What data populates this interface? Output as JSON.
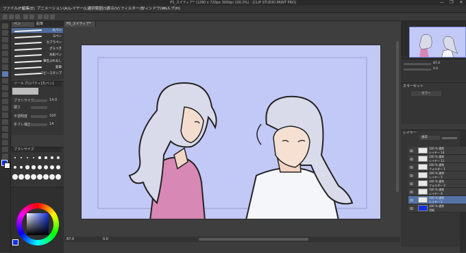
{
  "window": {
    "title": "PS_スイティア* (1280 x 720px 300dpi 100.0%) - [CLIP STUDIO PAINT PRO]",
    "controls": [
      "—",
      "❐",
      "✕"
    ]
  },
  "menu": [
    "ファイル(F)",
    "編集(E)",
    "アニメーション(A)",
    "レイヤー(L)",
    "選択範囲(S)",
    "表示(V)",
    "フィルター(I)",
    "ウィンドウ(W)",
    "ヘルプ(H)"
  ],
  "subtool": {
    "tabs": [
      "ペン",
      "鉛筆"
    ],
    "brushes": [
      "丸ペン",
      "Gペン",
      "カブラペン",
      "ざらつき",
      "水彩ペン",
      "筆圧ぶれなし",
      "鉛筆",
      "コピースタンプ"
    ],
    "selected_index": 0
  },
  "tool_property": {
    "title": "ツールプロパティ[丸ペン]",
    "rows": [
      {
        "label": "ブラシサイズ",
        "value": "14.0"
      },
      {
        "label": "硬さ",
        "value": ""
      },
      {
        "label": "不透明度",
        "value": "100"
      },
      {
        "label": "手ブレ補正",
        "value": "14"
      }
    ]
  },
  "brush_size_panel": {
    "title": "ブラシサイズ"
  },
  "canvas_tab": {
    "label": "PS_スイティア*"
  },
  "statusbar": {
    "zoom": "87.0",
    "angle": "0.0"
  },
  "navigator": {
    "zoom": "87.0",
    "angle": "0.0"
  },
  "colorset": {
    "title": "カラーセット",
    "set_name": "カラー"
  },
  "layers": {
    "title": "レイヤー",
    "blend": "通常",
    "rows": [
      {
        "mode": "100 % 通常",
        "name": "レイヤー 14",
        "selected": false
      },
      {
        "mode": "100 % 通常",
        "name": "レイヤー 11",
        "selected": false
      },
      {
        "mode": "100 % 通常",
        "name": "フォルダー 1",
        "selected": false
      },
      {
        "mode": "100 % 通常",
        "name": "レイヤー 5",
        "selected": false
      },
      {
        "mode": "100 % 通常",
        "name": "フォルダー 2",
        "selected": false
      },
      {
        "mode": "100 % 通常",
        "name": "レイヤー 6",
        "selected": false
      },
      {
        "mode": "100 % 通常",
        "name": "レイヤー 1",
        "selected": true
      },
      {
        "mode": "100 % 通常",
        "name": "用紙",
        "selected": false
      }
    ]
  },
  "colors": {
    "canvas_bg": "#c2c9f7",
    "accent": "#5572a8",
    "main_color": "#1030e0"
  }
}
